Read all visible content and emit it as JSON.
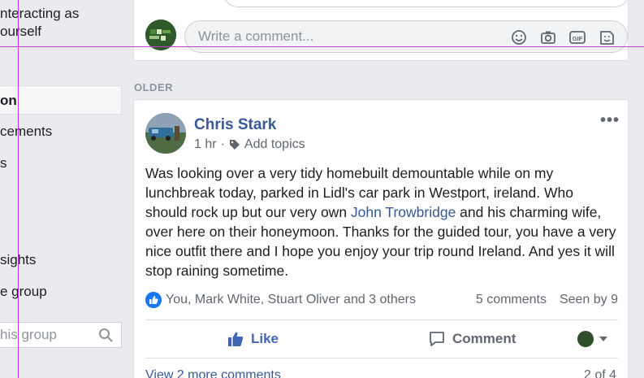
{
  "sidebar": {
    "partial_lines": [
      "nteracting as",
      "ourself"
    ],
    "items": [
      {
        "label": "on",
        "active": true
      },
      {
        "label": "cements"
      },
      {
        "label": "s"
      },
      {
        "label": "sights"
      },
      {
        "label": "e group"
      }
    ],
    "search_placeholder": "his group"
  },
  "composer": {
    "placeholder": "Write a comment...",
    "icons": [
      "emoji-icon",
      "camera-icon",
      "gif-icon",
      "sticker-icon"
    ],
    "gif_label": "GIF"
  },
  "section_label": "OLDER",
  "post": {
    "author": "Chris Stark",
    "time": "1 hr",
    "separator": "·",
    "add_topics": "Add topics",
    "more": "•••",
    "body_before": "Was looking over a very tidy homebuilt demountable while on my lunchbreak today, parked in Lidl's car park in Westport, ireland. Who should rock up but our very own ",
    "mention": "John Trowbridge",
    "body_after": " and his charming wife, over here on their honeymoon. Thanks for the guided tour, you have a very nice outfit there and I hope you enjoy your trip round Ireland. And yes it will stop raining sometime.",
    "reactions": "You, Mark White, Stuart Oliver and 3 others",
    "comment_count": "5 comments",
    "seen_by": "Seen by 9",
    "like_label": "Like",
    "comment_label": "Comment",
    "view_more": "View 2 more comments",
    "page_count": "2 of 4"
  },
  "colors": {
    "accent": "#385898",
    "like_blue": "#4267b2",
    "guide": "#c23bd4"
  }
}
